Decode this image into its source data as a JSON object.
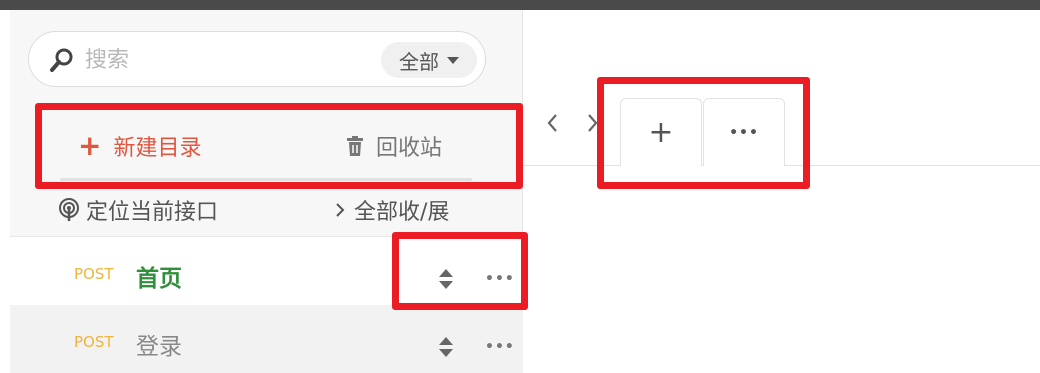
{
  "search": {
    "placeholder": "搜索",
    "scope_label": "全部"
  },
  "toolbar": {
    "new_dir_label": "新建目录",
    "recycle_label": "回收站"
  },
  "actions": {
    "locate_label": "定位当前接口",
    "toggle_all_label": "全部收/展"
  },
  "api_list": [
    {
      "method": "POST",
      "name": "首页"
    },
    {
      "method": "POST",
      "name": "登录"
    }
  ],
  "tabs": {
    "prev_icon": "chevron-left-icon",
    "next_icon": "chevron-right-icon",
    "add_label": "+",
    "more_label": "•••"
  },
  "colors": {
    "accent_red": "#e0563f",
    "method_post": "#f0b43c",
    "active_api": "#2f8f3a",
    "highlight": "#ec1c24"
  }
}
